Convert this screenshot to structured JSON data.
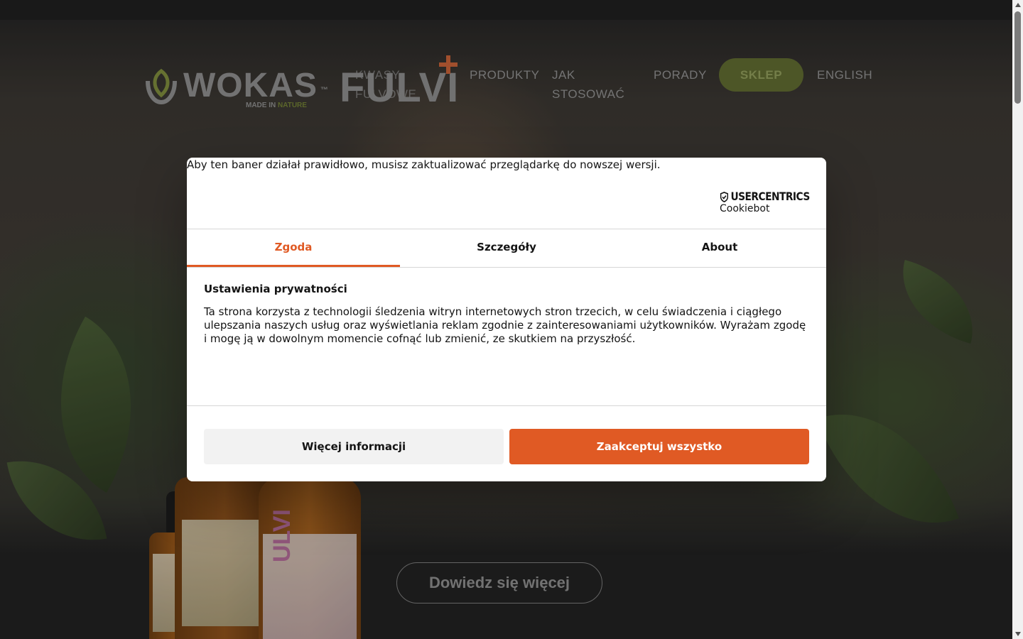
{
  "header": {
    "logo": {
      "name": "WOKAS",
      "tm": "™",
      "tagline_1": "MADE IN",
      "tagline_2": "NATURE"
    },
    "product_logo": "FULVI",
    "nav": [
      {
        "label": "KWASY FULVOWE"
      },
      {
        "label": "PRODUKTY"
      },
      {
        "label": "JAK STOSOWAĆ"
      },
      {
        "label": "PORADY"
      },
      {
        "label": "SKLEP"
      },
      {
        "label": "ENGLISH"
      }
    ]
  },
  "hero": {
    "cta_label": "Dowiedz się więcej",
    "bottle_label": "ULVI",
    "colors": {
      "accent_green": "#5f6a30",
      "fulvi_plus": "#c56138"
    }
  },
  "cookie_dialog": {
    "update_message": "Aby ten baner działał prawidłowo, musisz zaktualizować przeglądarkę do nowszej wersji.",
    "brand": {
      "name": "USERCENTRICS",
      "product": "Cookiebot",
      "icon": "shield-check-icon"
    },
    "tabs": [
      {
        "label": "Zgoda",
        "active": true
      },
      {
        "label": "Szczegóły",
        "active": false
      },
      {
        "label": "About",
        "active": false
      }
    ],
    "title": "Ustawienia prywatności",
    "text": "Ta strona korzysta z technologii śledzenia witryn internetowych stron trzecich, w celu świadczenia i ciągłego ulepszania naszych usług oraz wyświetlania reklam zgodnie z zainteresowaniami użytkowników. Wyrażam zgodę i mogę ją w dowolnym momencie cofnąć lub zmienić, ze skutkiem na przyszłość.",
    "buttons": {
      "more_info": "Więcej informacji",
      "accept_all": "Zaakceptuj wszystko"
    },
    "colors": {
      "accent": "#e05a24"
    }
  }
}
